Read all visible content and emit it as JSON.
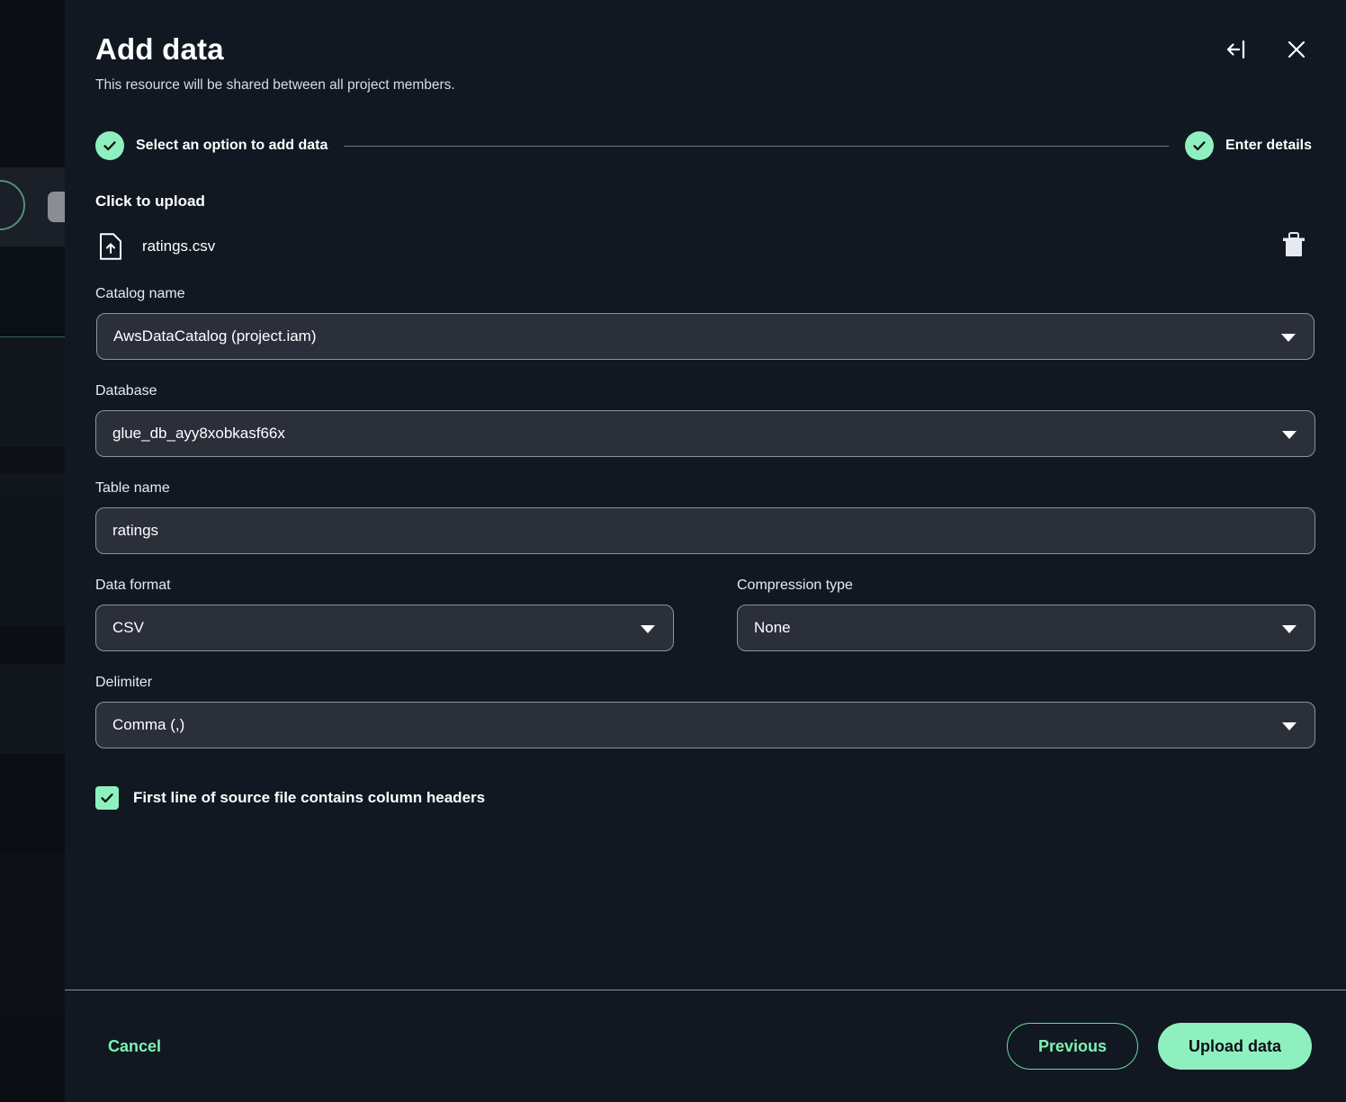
{
  "modal": {
    "title": "Add data",
    "subtitle": "This resource will be shared between all project members.",
    "collapse_icon": "arrow-to-bar-left-icon",
    "close_icon": "close-icon"
  },
  "stepper": {
    "steps": [
      {
        "label": "Select an option to add data",
        "state": "complete",
        "icon": "check-circle-icon"
      },
      {
        "label": "Enter details",
        "state": "complete",
        "icon": "check-circle-icon"
      }
    ]
  },
  "upload": {
    "heading": "Click to upload",
    "file_icon": "file-upload-icon",
    "file_name": "ratings.csv",
    "delete_icon": "trash-icon"
  },
  "fields": {
    "catalog": {
      "label": "Catalog name",
      "value": "AwsDataCatalog (project.iam)",
      "type": "select"
    },
    "database": {
      "label": "Database",
      "value": "glue_db_ayy8xobkasf66x",
      "type": "select"
    },
    "table": {
      "label": "Table name",
      "value": "ratings",
      "placeholder": "Table name",
      "type": "input"
    },
    "data_format": {
      "label": "Data format",
      "value": "CSV",
      "type": "select"
    },
    "compression": {
      "label": "Compression type",
      "value": "None",
      "type": "select"
    },
    "delimiter": {
      "label": "Delimiter",
      "value": "Comma (,)",
      "type": "select"
    }
  },
  "checkbox": {
    "label": "First line of source file contains column headers",
    "checked": true
  },
  "footer": {
    "cancel_label": "Cancel",
    "previous_label": "Previous",
    "upload_label": "Upload data"
  },
  "colors": {
    "accent_green": "#8ff0bf",
    "link_green": "#7df2b4",
    "modal_bg": "#111821",
    "field_bg": "#2a2f3a",
    "field_border": "#8b939e"
  }
}
